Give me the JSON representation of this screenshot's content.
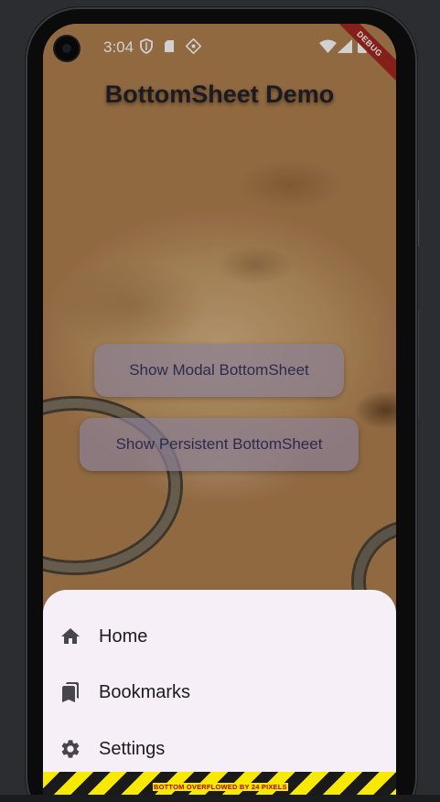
{
  "status_bar": {
    "time": "3:04",
    "icons": [
      "shield-icon",
      "sim-card-icon",
      "cast-icon",
      "wifi-icon",
      "signal-icon",
      "battery-icon"
    ]
  },
  "debug_banner": "DEBUG",
  "app": {
    "title": "BottomSheet Demo",
    "buttons": {
      "modal": "Show Modal BottomSheet",
      "persistent": "Show Persistent BottomSheet"
    }
  },
  "bottom_sheet": {
    "items": [
      {
        "label": "Home",
        "icon": "home-icon"
      },
      {
        "label": "Bookmarks",
        "icon": "bookmarks-icon"
      },
      {
        "label": "Settings",
        "icon": "gear-icon"
      }
    ],
    "overflow_message": "BOTTOM OVERFLOWED BY 24 PIXELS"
  },
  "colors": {
    "sheet_background": "#f6eff7",
    "button_background": "#8a8094",
    "button_text": "#2d2b4d",
    "debug_banner": "#a2271f",
    "overflow_stripe_yellow": "#f8e900"
  }
}
